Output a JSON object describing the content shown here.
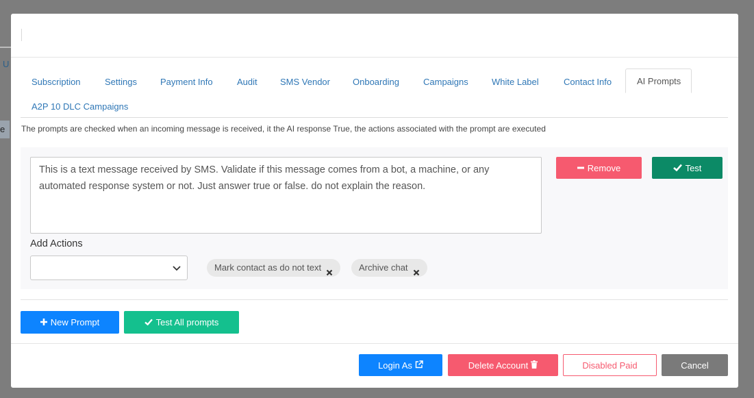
{
  "background": {
    "left_label_u": "U",
    "left_label_e": "e"
  },
  "tabs": [
    {
      "label": "Subscription"
    },
    {
      "label": "Settings"
    },
    {
      "label": "Payment Info"
    },
    {
      "label": "Audit"
    },
    {
      "label": "SMS Vendor"
    },
    {
      "label": "Onboarding"
    },
    {
      "label": "Campaigns"
    },
    {
      "label": "White Label"
    },
    {
      "label": "Contact Info"
    },
    {
      "label": "AI Prompts",
      "active": true
    },
    {
      "label": "A2P 10 DLC Campaigns"
    }
  ],
  "description": "The prompts are checked when an incoming message is received, it the AI response True, the actions associated with the prompt are executed",
  "prompt": {
    "text": "This is a text message received by SMS. Validate if this message comes from a bot, a machine, or any automated response system or not. Just answer true or false. do not explain the reason.",
    "remove_label": "Remove",
    "test_label": "Test",
    "add_actions_label": "Add Actions",
    "select_value": "",
    "actions": [
      {
        "label": "Mark contact as do not text"
      },
      {
        "label": "Archive chat"
      }
    ]
  },
  "buttons": {
    "new_prompt": "New Prompt",
    "test_all": "Test All prompts"
  },
  "footer": {
    "login_as": "Login As",
    "delete_account": "Delete Account",
    "disabled_paid": "Disabled Paid",
    "cancel": "Cancel"
  },
  "colors": {
    "primary": "#0d84ff",
    "danger": "#f65a6f",
    "success": "#0c8a66",
    "success_light": "#14c08e",
    "muted": "#7a7a7a",
    "link": "#2f77b6"
  }
}
